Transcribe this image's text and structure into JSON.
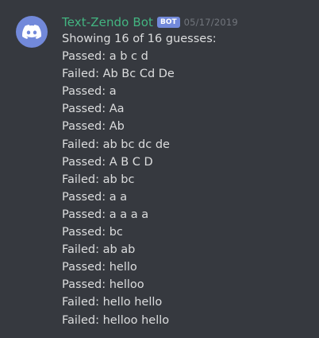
{
  "message": {
    "author": "Text-Zendo Bot",
    "badge": "BOT",
    "timestamp": "05/17/2019",
    "avatar_icon": "discord-logo-icon",
    "colors": {
      "background": "#36393f",
      "username": "#43b581",
      "badge": "#7289da",
      "text": "#dcddde",
      "timestamp": "#72767d"
    },
    "lines": [
      "Showing 16 of 16 guesses:",
      "Passed: a b c d",
      "Failed: Ab Bc Cd De",
      "Passed: a",
      "Passed: Aa",
      "Passed: Ab",
      "Failed: ab bc dc de",
      "Passed: A B C D",
      "Failed: ab bc",
      "Passed: a a",
      "Passed: a a a a",
      "Passed: bc",
      "Failed: ab ab",
      "Passed: hello",
      "Passed: helloo",
      "Failed: hello hello",
      "Failed: helloo hello"
    ]
  }
}
